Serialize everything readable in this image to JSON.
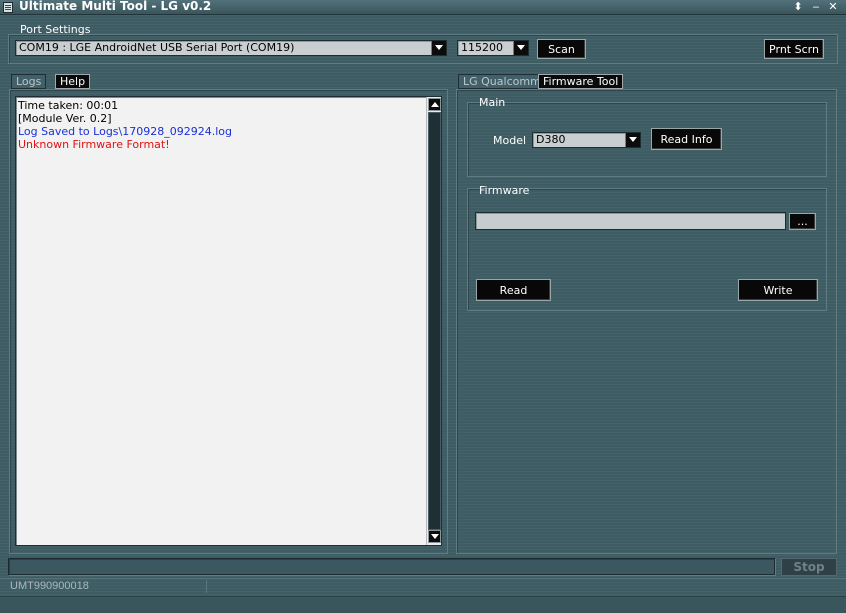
{
  "window": {
    "title": "Ultimate Multi Tool - LG v0.2",
    "controls": {
      "restore": "⬍",
      "minimize": "‒",
      "close": "✕"
    }
  },
  "port_settings": {
    "label": "Port Settings",
    "port": "COM19 : LGE AndroidNet USB Serial Port (COM19)",
    "baud": "115200",
    "scan_label": "Scan",
    "print_screen_label": "Prnt Scrn"
  },
  "left_tabs": [
    {
      "label": "Logs",
      "active": false
    },
    {
      "label": "Help",
      "active": true
    }
  ],
  "right_tabs": [
    {
      "label": "LG Qualcomm",
      "active": false
    },
    {
      "label": "Firmware Tool",
      "active": true
    }
  ],
  "logs": [
    {
      "text": "Time taken: 00:01",
      "color": "#000000"
    },
    {
      "text": "[Module Ver. 0.2]",
      "color": "#000000"
    },
    {
      "text": "Log Saved to Logs\\170928_092924.log",
      "color": "#1a2fd6"
    },
    {
      "text": "Unknown Firmware Format!",
      "color": "#e01313"
    }
  ],
  "main_group": {
    "label": "Main",
    "model_label": "Model",
    "model_value": "D380",
    "read_info_label": "Read Info"
  },
  "firmware_group": {
    "label": "Firmware",
    "path_value": "",
    "browse_label": "...",
    "read_label": "Read",
    "write_label": "Write"
  },
  "progress": {
    "percent": 0
  },
  "stop_label": "Stop",
  "status": {
    "serial": "UMT990900018"
  },
  "icons": {
    "app": "app-icon",
    "dropdown": "chevron-down-icon",
    "scroll_up": "arrow-up-icon",
    "scroll_down": "arrow-down-icon"
  }
}
